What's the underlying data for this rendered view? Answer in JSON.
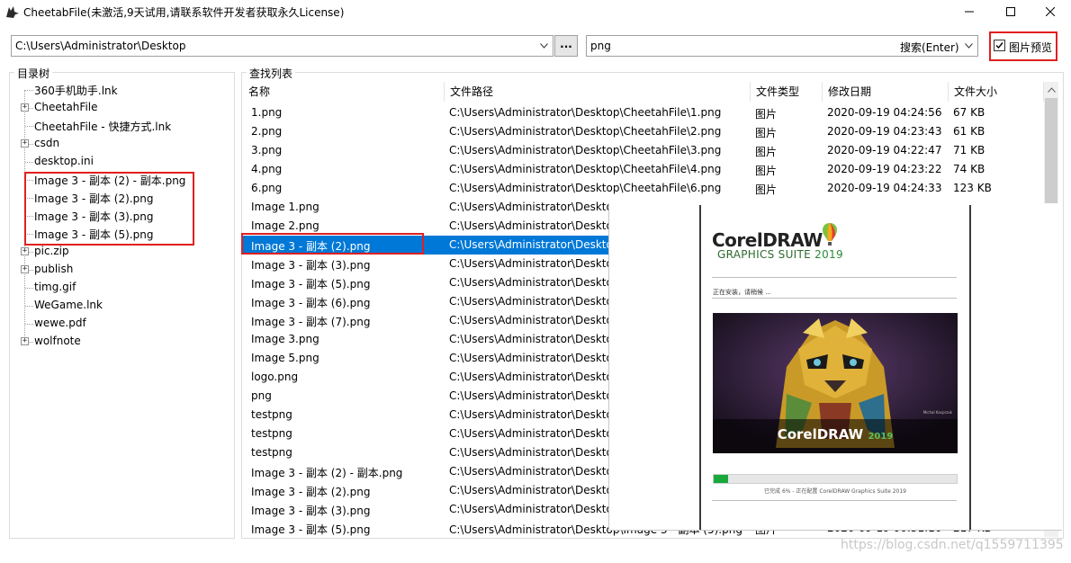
{
  "window": {
    "title": "CheetabFile(未激活,9天试用,请联系软件开发者获取永久License)",
    "app_icon": "cheetah-icon",
    "controls": [
      "minimize-icon",
      "maximize-icon",
      "close-icon"
    ]
  },
  "toolbar": {
    "path_value": "C:\\Users\\Administrator\\Desktop",
    "browse_label": "...",
    "search_value": "png",
    "search_hint": "搜索(Enter)",
    "preview_label": "图片预览",
    "preview_checked": true
  },
  "tree": {
    "title": "目录树",
    "items": [
      {
        "label": "360手机助手.lnk",
        "expandable": false
      },
      {
        "label": "CheetahFile",
        "expandable": true
      },
      {
        "label": "CheetahFile - 快捷方式.lnk",
        "expandable": false
      },
      {
        "label": "csdn",
        "expandable": true
      },
      {
        "label": "desktop.ini",
        "expandable": false
      },
      {
        "label": "Image 3 - 副本 (2) - 副本.png",
        "expandable": false
      },
      {
        "label": "Image 3 - 副本 (2).png",
        "expandable": false
      },
      {
        "label": "Image 3 - 副本 (3).png",
        "expandable": false
      },
      {
        "label": "Image 3 - 副本 (5).png",
        "expandable": false
      },
      {
        "label": "pic.zip",
        "expandable": true
      },
      {
        "label": "publish",
        "expandable": true
      },
      {
        "label": "timg.gif",
        "expandable": false
      },
      {
        "label": "WeGame.lnk",
        "expandable": false
      },
      {
        "label": "wewe.pdf",
        "expandable": false
      },
      {
        "label": "wolfnote",
        "expandable": true
      }
    ]
  },
  "results": {
    "title": "查找列表",
    "columns": [
      "名称",
      "文件路径",
      "文件类型",
      "修改日期",
      "文件大小"
    ],
    "rows": [
      {
        "name": "1.png",
        "path": "C:\\Users\\Administrator\\Desktop\\CheetahFile\\1.png",
        "type": "图片",
        "date": "2020-09-19 04:24:56",
        "size": "67 KB"
      },
      {
        "name": "2.png",
        "path": "C:\\Users\\Administrator\\Desktop\\CheetahFile\\2.png",
        "type": "图片",
        "date": "2020-09-19 04:23:43",
        "size": "61 KB"
      },
      {
        "name": "3.png",
        "path": "C:\\Users\\Administrator\\Desktop\\CheetahFile\\3.png",
        "type": "图片",
        "date": "2020-09-19 04:22:47",
        "size": "71 KB"
      },
      {
        "name": "4.png",
        "path": "C:\\Users\\Administrator\\Desktop\\CheetahFile\\4.png",
        "type": "图片",
        "date": "2020-09-19 04:23:22",
        "size": "74 KB"
      },
      {
        "name": "6.png",
        "path": "C:\\Users\\Administrator\\Desktop\\CheetahFile\\6.png",
        "type": "图片",
        "date": "2020-09-19 04:24:33",
        "size": "123 KB"
      },
      {
        "name": "Image 1.png",
        "path": "C:\\Users\\Administrator\\Deskto",
        "type": "",
        "date": "",
        "size": ""
      },
      {
        "name": "Image 2.png",
        "path": "C:\\Users\\Administrator\\Deskto",
        "type": "",
        "date": "",
        "size": ""
      },
      {
        "name": "Image 3 - 副本 (2).png",
        "path": "C:\\Users\\Administrator\\Deskto",
        "type": "",
        "date": "",
        "size": "",
        "selected": true
      },
      {
        "name": "Image 3 - 副本 (3).png",
        "path": "C:\\Users\\Administrator\\Deskto",
        "type": "",
        "date": "",
        "size": ""
      },
      {
        "name": "Image 3 - 副本 (5).png",
        "path": "C:\\Users\\Administrator\\Deskto",
        "type": "",
        "date": "",
        "size": ""
      },
      {
        "name": "Image 3 - 副本 (6).png",
        "path": "C:\\Users\\Administrator\\Deskto",
        "type": "",
        "date": "",
        "size": ""
      },
      {
        "name": "Image 3 - 副本 (7).png",
        "path": "C:\\Users\\Administrator\\Deskto",
        "type": "",
        "date": "",
        "size": ""
      },
      {
        "name": "Image 3.png",
        "path": "C:\\Users\\Administrator\\Deskto",
        "type": "",
        "date": "",
        "size": ""
      },
      {
        "name": "Image 5.png",
        "path": "C:\\Users\\Administrator\\Deskto",
        "type": "",
        "date": "",
        "size": ""
      },
      {
        "name": "logo.png",
        "path": "C:\\Users\\Administrator\\Deskto",
        "type": "",
        "date": "",
        "size": ""
      },
      {
        "name": "png",
        "path": "C:\\Users\\Administrator\\Deskto",
        "type": "",
        "date": "",
        "size": ""
      },
      {
        "name": "testpng",
        "path": "C:\\Users\\Administrator\\Deskto",
        "type": "",
        "date": "",
        "size": ""
      },
      {
        "name": "testpng",
        "path": "C:\\Users\\Administrator\\Deskto",
        "type": "",
        "date": "",
        "size": ""
      },
      {
        "name": "testpng",
        "path": "C:\\Users\\Administrator\\Deskto",
        "type": "",
        "date": "",
        "size": ""
      },
      {
        "name": "Image 3 - 副本 (2) - 副本.png",
        "path": "C:\\Users\\Administrator\\Deskto",
        "type": "",
        "date": "",
        "size": ""
      },
      {
        "name": "Image 3 - 副本 (2).png",
        "path": "C:\\Users\\Administrator\\Deskto",
        "type": "",
        "date": "",
        "size": ""
      },
      {
        "name": "Image 3 - 副本 (3).png",
        "path": "C:\\Users\\Administrator\\Deskto",
        "type": "",
        "date": "",
        "size": ""
      },
      {
        "name": "Image 3 - 副本 (5).png",
        "path": "C:\\Users\\Administrator\\Desktop\\Image 3 - 副本 (5).png",
        "type": "图片",
        "date": "2020-09-19 00:31:10",
        "size": "217 KB"
      }
    ]
  },
  "preview": {
    "product_title": "CorelDRAW",
    "product_sub": "GRAPHICS SUITE",
    "product_year": "2019",
    "status_installing": "正在安装，请稍候 ...",
    "splash_artist": "Michal Kasprzak",
    "splash_brand": "CorelDRAW",
    "splash_year": "2019",
    "progress": 0.06,
    "progress_text": "已完成  6% - 正在配置 CorelDRAW Graphics Suite 2019"
  },
  "watermark": "https://blog.csdn.net/q1559711395",
  "colors": {
    "accent": "#0078d7",
    "highlight_box": "#e02020",
    "progress": "#18a83c"
  }
}
